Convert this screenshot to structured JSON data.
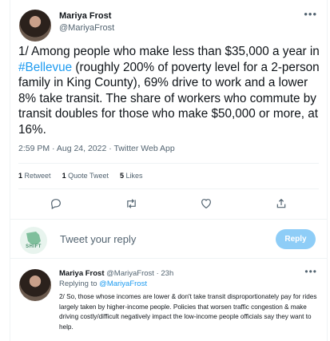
{
  "tweet": {
    "author_name": "Mariya Frost",
    "author_handle": "@MariyaFrost",
    "more_icon": "•••",
    "text_part1": "1/ Among people who make less than $35,000 a year in ",
    "hashtag": "#Bellevue",
    "text_part2": " (roughly 200% of poverty level for a 2-person family in King County), 69% drive to work and a lower 8% take transit. The share of workers who commute by transit doubles for those who make $50,000 or more, at 16%.",
    "timestamp": "2:59 PM · Aug 24, 2022 · Twitter Web App",
    "stats": {
      "retweets_count": "1",
      "retweets_label": "Retweet",
      "quotes_count": "1",
      "quotes_label": "Quote Tweet",
      "likes_count": "5",
      "likes_label": "Likes"
    },
    "actions": [
      "reply-icon",
      "retweet-icon",
      "like-icon",
      "share-icon"
    ]
  },
  "reply_composer": {
    "logo_text": "SHIFT",
    "placeholder": "Tweet your reply",
    "button_label": "Reply"
  },
  "reply_tweet": {
    "author_name": "Mariya Frost",
    "author_handle": "@MariyaFrost",
    "separator": " · ",
    "time": "23h",
    "replying_prefix": "Replying to ",
    "replying_to": "@MariyaFrost",
    "text": "2/ So, those whose incomes are lower & don't take transit disproportionately pay for rides largely taken by higher-income people. Policies that worsen traffic congestion & make driving costly/difficult negatively impact the low-income people officials say they want to help.",
    "more_icon": "•••"
  },
  "colors": {
    "accent": "#1d9bf0",
    "secondary_text": "#536471",
    "reply_button_disabled": "#8ecdf7"
  }
}
